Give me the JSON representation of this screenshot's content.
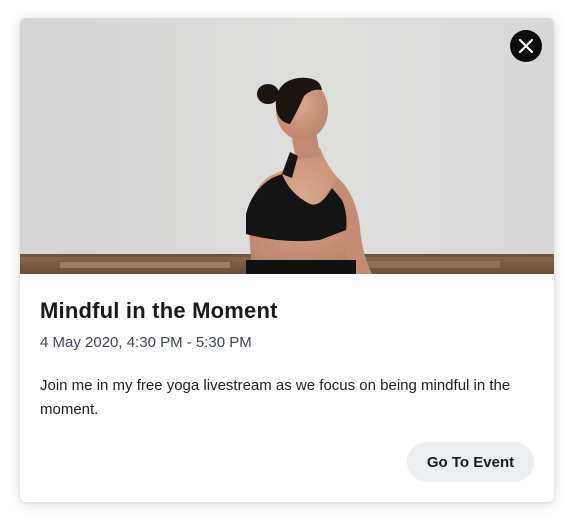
{
  "event": {
    "title": "Mindful in the Moment",
    "datetime": "4 May 2020, 4:30 PM - 5:30 PM",
    "description": "Join me in my free yoga livestream as we focus on being mindful in the moment.",
    "cta_label": "Go To Event"
  },
  "icons": {
    "close": "close-icon"
  },
  "colors": {
    "close_button_bg": "#0b0b0b",
    "cta_button_bg": "#eceef2",
    "date_text": "#3f4552"
  }
}
